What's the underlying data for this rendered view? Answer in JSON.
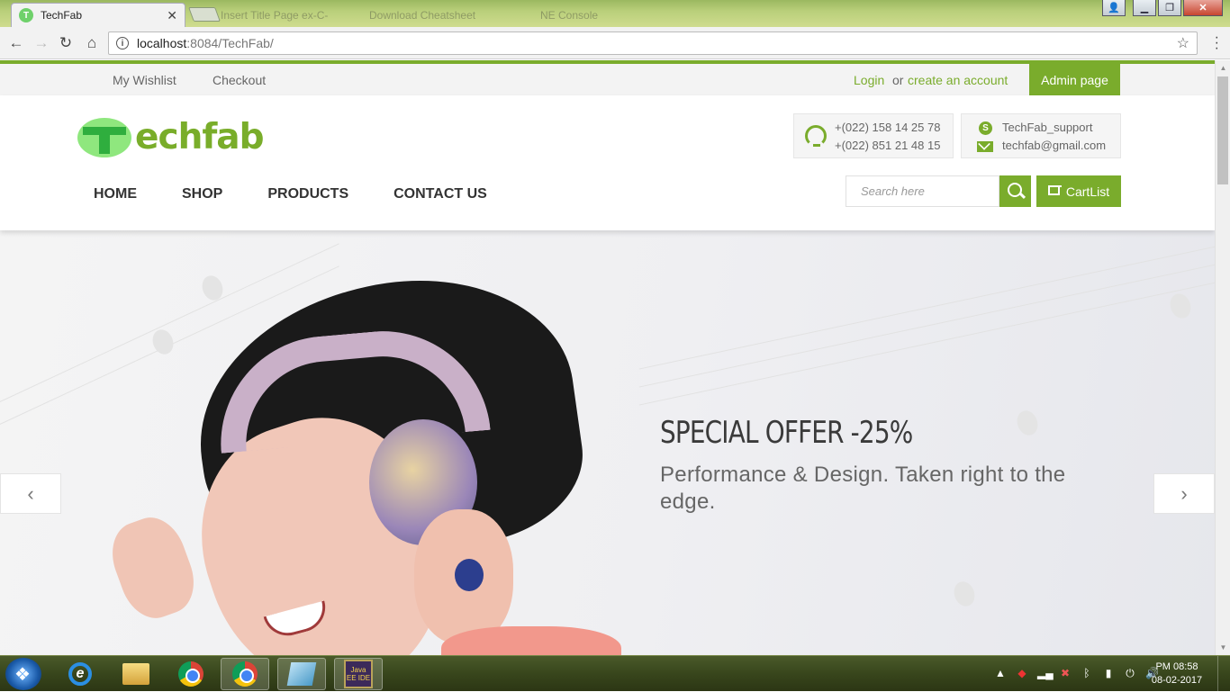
{
  "browser": {
    "active_tab": {
      "title": "TechFab",
      "favicon": "techfab-favicon"
    },
    "inactive_tabs": [
      "Insert Title Page  ex-C-",
      "Download Cheatsheet",
      "NE Console"
    ],
    "url_host": "localhost",
    "url_rest": ":8084/TechFab/"
  },
  "topbar": {
    "wishlist": "My Wishlist",
    "checkout": "Checkout",
    "login": "Login",
    "or": "or",
    "create_account": "create an account",
    "admin": "Admin page"
  },
  "logo": {
    "text": "echfab"
  },
  "contact": {
    "phone1": "+(022) 158 14 25 78",
    "phone2": "+(022) 851 21 48 15",
    "skype": "TechFab_support",
    "email": "techfab@gmail.com"
  },
  "nav": {
    "home": "HOME",
    "shop": "SHOP",
    "products": "PRODUCTS",
    "contact": "CONTACT US"
  },
  "search": {
    "placeholder": "Search here"
  },
  "cart": {
    "label": "CartList"
  },
  "slide": {
    "title": "SPECIAL OFFER -25%",
    "subtitle": "Performance & Design. Taken right to the edge."
  },
  "taskbar": {
    "java_label": "Java EE IDE",
    "time": "PM 08:58",
    "date": "08-02-2017"
  },
  "colors": {
    "accent": "#7aac2c"
  }
}
